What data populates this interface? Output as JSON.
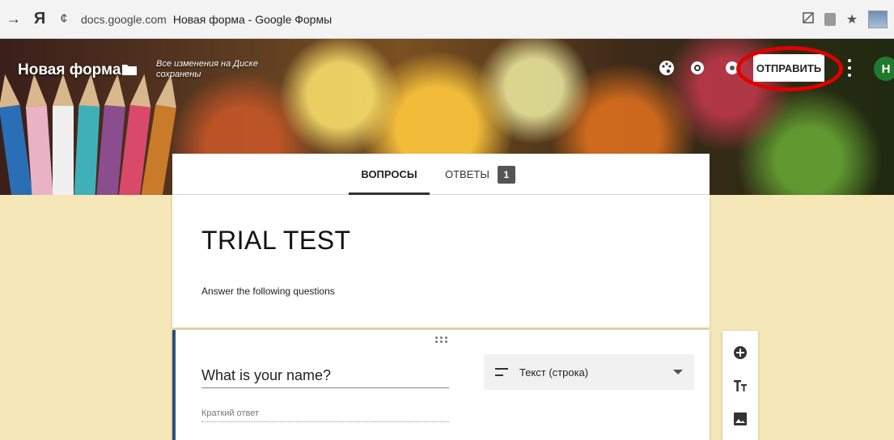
{
  "browser": {
    "back_symbol": "→",
    "ya_symbol": "Я",
    "reload_symbol": "¢",
    "domain": "docs.google.com",
    "page_title": "Новая форма - Google Формы",
    "star_symbol": "★"
  },
  "header": {
    "form_name": "Новая форма",
    "save_status": "Все изменения на Диске сохранены",
    "send_label": "ОТПРАВИТЬ",
    "avatar_letter": "Н",
    "highlight_color": "#e00000"
  },
  "tabs": {
    "questions_label": "ВОПРОСЫ",
    "answers_label": "ОТВЕТЫ",
    "answers_count": "1"
  },
  "form": {
    "title": "TRIAL TEST",
    "description": "Answer the following questions"
  },
  "question": {
    "text": "What is your name?",
    "answer_placeholder": "Краткий ответ",
    "type_label": "Текст (строка)"
  },
  "icons": {
    "palette": "palette-icon",
    "preview": "eye-icon",
    "settings": "gear-icon",
    "more": "more-vert-icon",
    "add": "add-circle-icon",
    "title": "text-title-icon",
    "image": "image-icon"
  }
}
